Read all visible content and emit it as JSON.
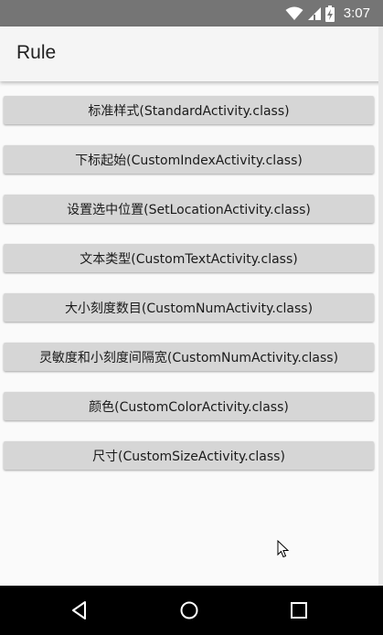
{
  "status_bar": {
    "time": "3:07",
    "icons": [
      "wifi-icon",
      "cell-signal-icon",
      "battery-charging-icon"
    ]
  },
  "app_bar": {
    "title": "Rule"
  },
  "buttons": [
    {
      "label": "标准样式(StandardActivity.class)"
    },
    {
      "label": "下标起始(CustomIndexActivity.class)"
    },
    {
      "label": "设置选中位置(SetLocationActivity.class)"
    },
    {
      "label": "文本类型(CustomTextActivity.class)"
    },
    {
      "label": "大小刻度数目(CustomNumActivity.class)"
    },
    {
      "label": "灵敏度和小刻度间隔宽(CustomNumActivity.class)"
    },
    {
      "label": "颜色(CustomColorActivity.class)"
    },
    {
      "label": "尺寸(CustomSizeActivity.class)"
    }
  ],
  "nav_bar": {
    "icons": [
      "back-icon",
      "home-icon",
      "recents-icon"
    ]
  },
  "colors": {
    "status_bar": "#757575",
    "app_bar": "#f5f5f5",
    "button": "#d6d6d6",
    "background": "#fafafa",
    "nav_bar": "#000000"
  }
}
